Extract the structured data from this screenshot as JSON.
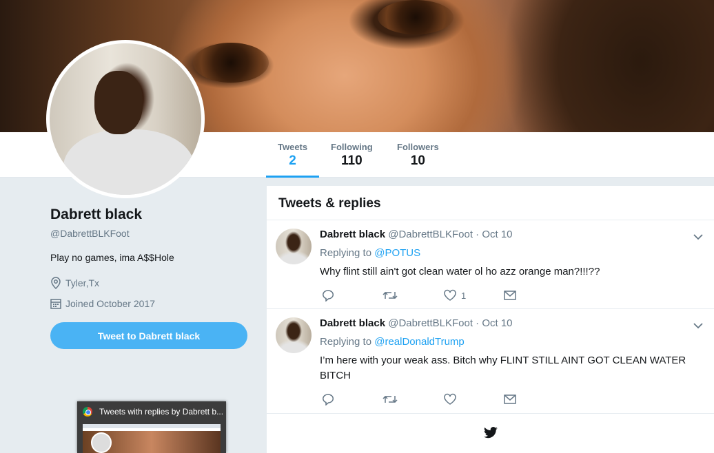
{
  "nav": {
    "tweets": {
      "label": "Tweets",
      "count": "2"
    },
    "following": {
      "label": "Following",
      "count": "110"
    },
    "followers": {
      "label": "Followers",
      "count": "10"
    }
  },
  "profile": {
    "name": "Dabrett black",
    "handle": "@DabrettBLKFoot",
    "bio": "Play no games, ima A$$Hole",
    "location": "Tyler,Tx",
    "joined": "Joined October 2017",
    "tweet_to_label": "Tweet to Dabrett black"
  },
  "timeline": {
    "title": "Tweets & replies",
    "tweets": [
      {
        "name": "Dabrett black",
        "handle_date": "@DabrettBLKFoot · Oct 10",
        "replying_prefix": "Replying to",
        "replying_to": "@POTUS",
        "text": "Why flint still ain't got clean water ol ho  azz orange man?!!!??",
        "likes": "1"
      },
      {
        "name": "Dabrett black",
        "handle_date": "@DabrettBLKFoot · Oct 10",
        "replying_prefix": "Replying to",
        "replying_to": "@realDonaldTrump",
        "text": "I’m here with your weak ass. Bitch why FLINT STILL AINT GOT CLEAN WATER BITCH",
        "likes": ""
      }
    ]
  },
  "taskbar_thumbnail": {
    "title": "Tweets with replies by Dabrett b..."
  },
  "colors": {
    "accent": "#1da1f2",
    "button": "#4ab3f4",
    "muted": "#657786",
    "background": "#e6ecf0"
  }
}
